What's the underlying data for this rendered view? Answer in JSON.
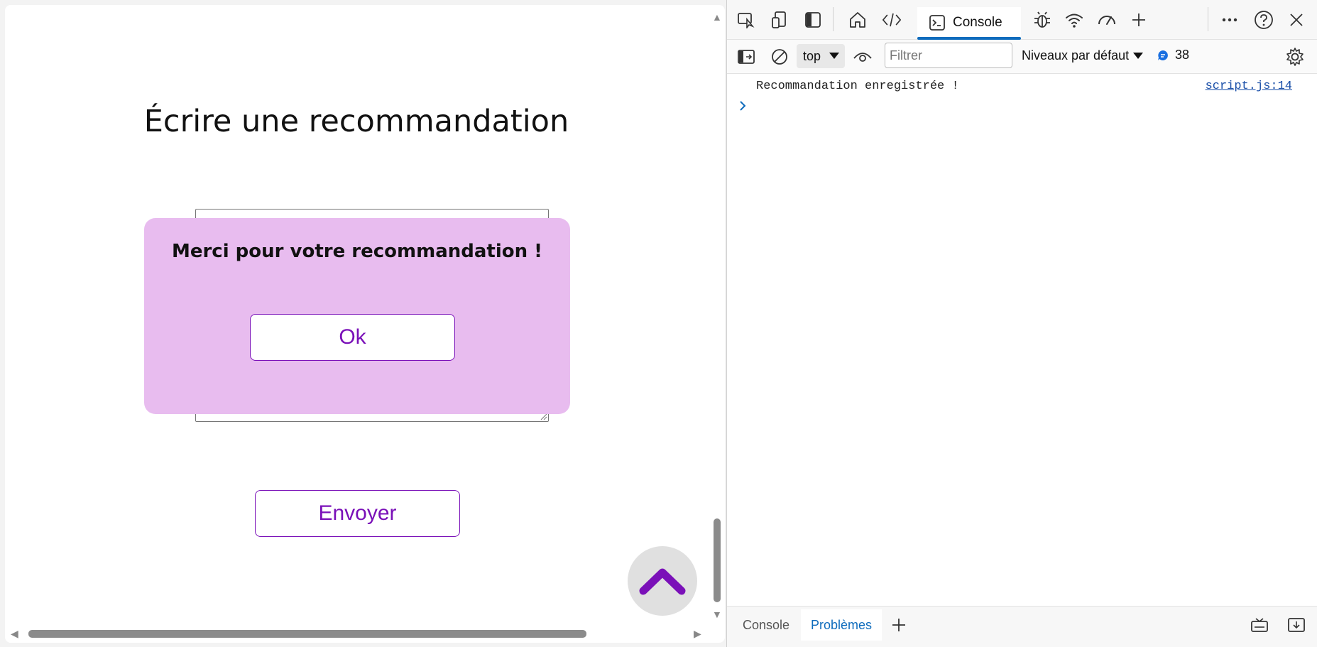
{
  "page": {
    "title": "Écrire une recommandation",
    "textarea_placeholder": "",
    "send_label": "Envoyer",
    "modal": {
      "message": "Merci pour votre recommandation !",
      "ok_label": "Ok"
    }
  },
  "devtools": {
    "main_tab": "Console",
    "context": "top",
    "filter_placeholder": "Filtrer",
    "levels_label": "Niveaux par défaut",
    "message_count": "38",
    "log": {
      "message": "Recommandation enregistrée !",
      "source": "script.js:14"
    },
    "bottom_tabs": [
      "Console",
      "Problèmes"
    ]
  },
  "colors": {
    "accent": "#7a10b8",
    "modal_bg": "#e8bcef",
    "devtools_blue": "#0f6cbd"
  }
}
